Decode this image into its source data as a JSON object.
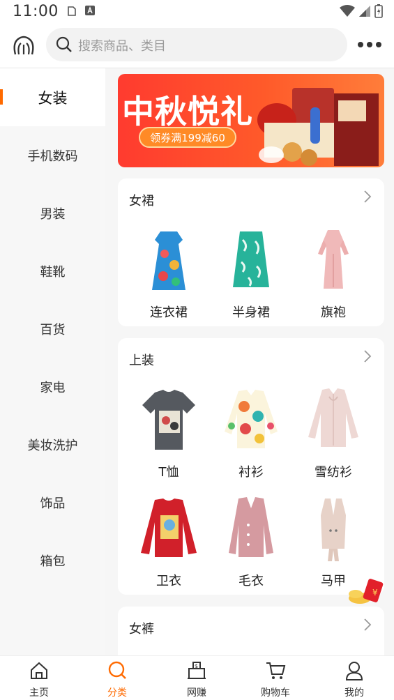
{
  "status_bar": {
    "time": "11:00"
  },
  "search": {
    "placeholder": "搜索商品、类目"
  },
  "sidebar": {
    "items": [
      {
        "label": "女装",
        "active": true
      },
      {
        "label": "手机数码"
      },
      {
        "label": "男装"
      },
      {
        "label": "鞋靴"
      },
      {
        "label": "百货"
      },
      {
        "label": "家电"
      },
      {
        "label": "美妆洗护"
      },
      {
        "label": "饰品"
      },
      {
        "label": "箱包"
      }
    ]
  },
  "banner": {
    "title": "中秋悦礼",
    "coupon": "领券满199减60"
  },
  "sections": [
    {
      "title": "女裙",
      "items": [
        {
          "label": "连衣裙"
        },
        {
          "label": "半身裙"
        },
        {
          "label": "旗袍"
        }
      ]
    },
    {
      "title": "上装",
      "items": [
        {
          "label": "T恤"
        },
        {
          "label": "衬衫"
        },
        {
          "label": "雪纺衫"
        },
        {
          "label": "卫衣"
        },
        {
          "label": "毛衣"
        },
        {
          "label": "马甲"
        }
      ]
    },
    {
      "title": "女裤",
      "items": []
    }
  ],
  "bottom_nav": [
    {
      "label": "主页",
      "icon": "home-icon"
    },
    {
      "label": "分类",
      "icon": "search-icon",
      "active": true
    },
    {
      "label": "网赚",
      "icon": "cash-register-icon"
    },
    {
      "label": "购物车",
      "icon": "cart-icon"
    },
    {
      "label": "我的",
      "icon": "user-icon"
    }
  ],
  "colors": {
    "accent": "#ff6a00",
    "banner": "#ff3b2f"
  }
}
